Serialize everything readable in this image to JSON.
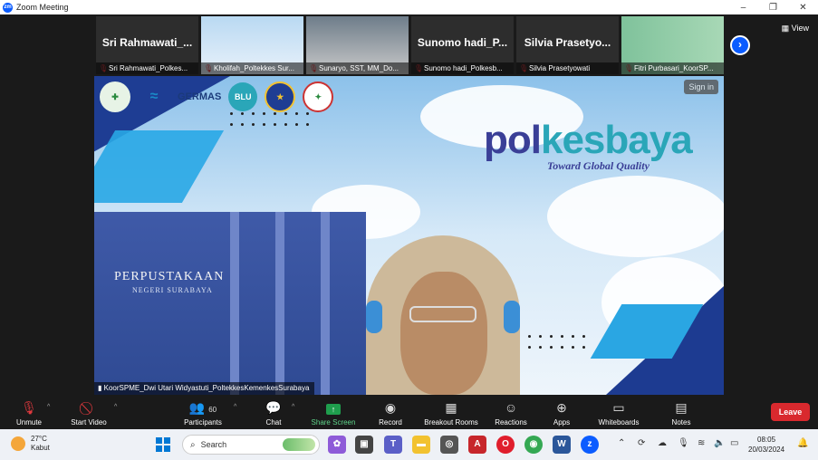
{
  "window": {
    "title": "Zoom Meeting",
    "controls": [
      "–",
      "❐",
      "✕"
    ]
  },
  "view_label": "View",
  "participants_strip": [
    {
      "big_name": "Sri Rahmawati_...",
      "caption": "Sri Rahmawati_Polkes...",
      "video": false
    },
    {
      "big_name": "",
      "caption": "Kholifah_Poltekkes Sur...",
      "video": true
    },
    {
      "big_name": "",
      "caption": "Sunaryo, SST, MM_Do...",
      "video": true
    },
    {
      "big_name": "Sunomo hadi_P...",
      "caption": "Sunomo hadi_Polkesb...",
      "video": false
    },
    {
      "big_name": "Silvia Prasetyo...",
      "caption": "Silvia Prasetyowati",
      "video": false
    },
    {
      "big_name": "",
      "caption": "Fitri Purbasari_KoorSP...",
      "video": true
    }
  ],
  "stage": {
    "sign_in": "Sign in",
    "brand_left": "pol",
    "brand_right": "kesbaya",
    "tagline": "Toward Global Quality",
    "building_sign": "PERPUSTAKAAN",
    "building_sub": "NEGERI SURABAYA",
    "logo_labels": [
      "GERMAS",
      "BLU"
    ],
    "speaker_caption": "KoorSPME_Dwi Utari Widyastuti_PoltekkesKemenkesSurabaya"
  },
  "toolbar": {
    "unmute": "Unmute",
    "start_video": "Start Video",
    "participants": "Participants",
    "participants_count": "60",
    "chat": "Chat",
    "share_screen": "Share Screen",
    "record": "Record",
    "breakout_rooms": "Breakout Rooms",
    "reactions": "Reactions",
    "apps": "Apps",
    "whiteboards": "Whiteboards",
    "notes": "Notes",
    "leave": "Leave"
  },
  "taskbar": {
    "temperature": "27°C",
    "weather": "Kabut",
    "search_placeholder": "Search",
    "time": "08:05",
    "date": "20/03/2024"
  },
  "colors": {
    "zoom_blue": "#0b5cff",
    "leave_red": "#d9292e",
    "share_green": "#1f9e4d"
  }
}
